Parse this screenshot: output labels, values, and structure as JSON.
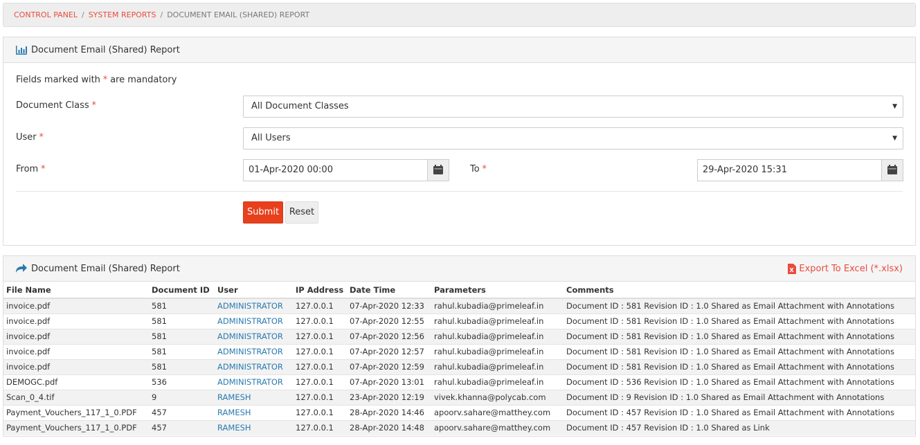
{
  "breadcrumb": {
    "items": [
      "CONTROL PANEL",
      "SYSTEM REPORTS"
    ],
    "separator": "/",
    "current": "DOCUMENT EMAIL (SHARED) REPORT"
  },
  "form": {
    "title": "Document Email (Shared) Report",
    "mandatory_prefix": "Fields marked with",
    "mandatory_star": "*",
    "mandatory_suffix": "are mandatory",
    "document_class_label": "Document Class",
    "document_class_value": "All Document Classes",
    "user_label": "User",
    "user_value": "All Users",
    "from_label": "From",
    "from_value": "01-Apr-2020 00:00",
    "to_label": "To",
    "to_value": "29-Apr-2020 15:31",
    "submit_label": "Submit",
    "reset_label": "Reset"
  },
  "report": {
    "title": "Document Email (Shared) Report",
    "export_label": "Export To Excel (*.xlsx)",
    "columns": [
      "File Name",
      "Document ID",
      "User",
      "IP Address",
      "Date Time",
      "Parameters",
      "Comments"
    ],
    "rows": [
      [
        "invoice.pdf",
        "581",
        "ADMINISTRATOR",
        "127.0.0.1",
        "07-Apr-2020 12:33",
        "rahul.kubadia@primeleaf.in",
        "Document ID : 581 Revision ID : 1.0 Shared as Email Attachment with Annotations"
      ],
      [
        "invoice.pdf",
        "581",
        "ADMINISTRATOR",
        "127.0.0.1",
        "07-Apr-2020 12:55",
        "rahul.kubadia@primeleaf.in",
        "Document ID : 581 Revision ID : 1.0 Shared as Email Attachment with Annotations"
      ],
      [
        "invoice.pdf",
        "581",
        "ADMINISTRATOR",
        "127.0.0.1",
        "07-Apr-2020 12:56",
        "rahul.kubadia@primeleaf.in",
        "Document ID : 581 Revision ID : 1.0 Shared as Email Attachment with Annotations"
      ],
      [
        "invoice.pdf",
        "581",
        "ADMINISTRATOR",
        "127.0.0.1",
        "07-Apr-2020 12:57",
        "rahul.kubadia@primeleaf.in",
        "Document ID : 581 Revision ID : 1.0 Shared as Email Attachment with Annotations"
      ],
      [
        "invoice.pdf",
        "581",
        "ADMINISTRATOR",
        "127.0.0.1",
        "07-Apr-2020 12:59",
        "rahul.kubadia@primeleaf.in",
        "Document ID : 581 Revision ID : 1.0 Shared as Email Attachment with Annotations"
      ],
      [
        "DEMOGC.pdf",
        "536",
        "ADMINISTRATOR",
        "127.0.0.1",
        "07-Apr-2020 13:01",
        "rahul.kubadia@primeleaf.in",
        "Document ID : 536 Revision ID : 1.0 Shared as Email Attachment with Annotations"
      ],
      [
        "Scan_0_4.tif",
        "9",
        "RAMESH",
        "127.0.0.1",
        "23-Apr-2020 12:19",
        "vivek.khanna@polycab.com",
        "Document ID : 9 Revision ID : 1.0 Shared as Email Attachment with Annotations"
      ],
      [
        "Payment_Vouchers_117_1_0.PDF",
        "457",
        "RAMESH",
        "127.0.0.1",
        "28-Apr-2020 14:46",
        "apoorv.sahare@matthey.com",
        "Document ID : 457 Revision ID : 1.0 Shared as Email Attachment with Annotations"
      ],
      [
        "Payment_Vouchers_117_1_0.PDF",
        "457",
        "RAMESH",
        "127.0.0.1",
        "28-Apr-2020 14:48",
        "apoorv.sahare@matthey.com",
        "Document ID : 457 Revision ID : 1.0 Shared as Link"
      ]
    ]
  },
  "colors": {
    "accent": "#e84c3d",
    "link": "#2a7ab0",
    "submit": "#e8401d"
  },
  "icons": {
    "form_heading": "bar-chart-icon",
    "report_heading": "share-arrow-icon",
    "export": "excel-file-icon",
    "date_picker": "calendar-icon",
    "dropdown": "chevron-down-icon"
  }
}
